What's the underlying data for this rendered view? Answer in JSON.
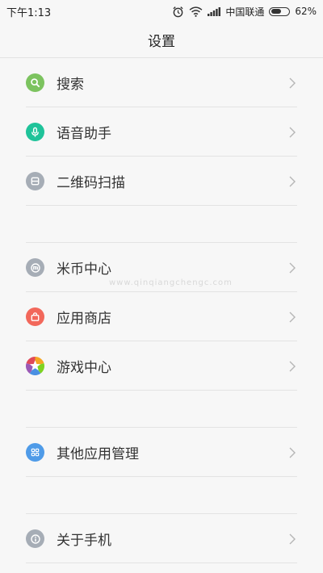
{
  "status_bar": {
    "time": "下午1:13",
    "carrier": "中国联通",
    "battery_percent": "62%",
    "battery_level": 0.62,
    "icons": [
      "alarm-icon",
      "wifi-icon",
      "signal-icon",
      "battery-icon"
    ]
  },
  "header": {
    "title": "设置"
  },
  "groups": [
    {
      "items": [
        {
          "label": "搜索",
          "icon": "search-icon",
          "color": "#7cc35f"
        },
        {
          "label": "语音助手",
          "icon": "microphone-icon",
          "color": "#1fc39a"
        },
        {
          "label": "二维码扫描",
          "icon": "qr-scan-icon",
          "color": "#a6adb6"
        }
      ]
    },
    {
      "items": [
        {
          "label": "米币中心",
          "icon": "mi-coin-icon",
          "color": "#a6adb6"
        },
        {
          "label": "应用商店",
          "icon": "shopping-bag-icon",
          "color": "#f2685b"
        },
        {
          "label": "游戏中心",
          "icon": "star-icon",
          "color": "#e04a5a"
        }
      ]
    },
    {
      "items": [
        {
          "label": "其他应用管理",
          "icon": "grid-icon",
          "color": "#4f9be8"
        }
      ]
    },
    {
      "items": [
        {
          "label": "关于手机",
          "icon": "info-icon",
          "color": "#a6adb6"
        }
      ]
    }
  ],
  "watermark": "www.qinqiangchengc.com"
}
